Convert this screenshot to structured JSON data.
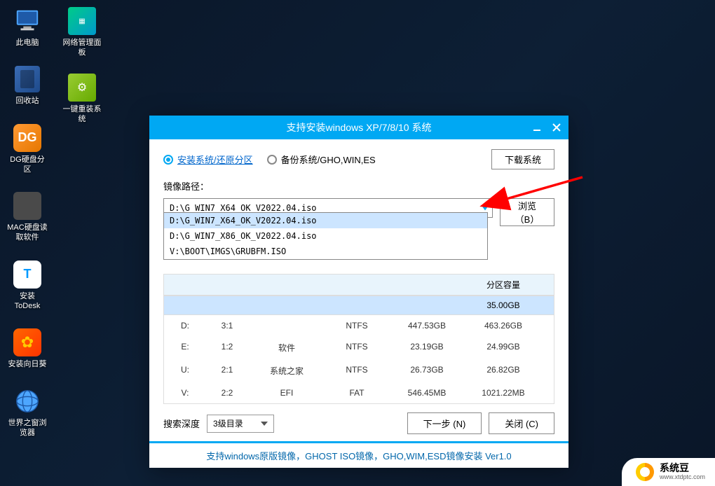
{
  "desktop": {
    "thispc": "此电脑",
    "recycle": "回收站",
    "dg": "DG硬盘分区",
    "mac": "MAC硬盘读取软件",
    "todesk": "安装ToDesk",
    "sunflower": "安装向日葵",
    "browser": "世界之窗浏览器",
    "network": "网络管理面板",
    "reinstall": "一键重装系统"
  },
  "dialog": {
    "title": "支持安装windows XP/7/8/10 系统",
    "radio_install": "安装系统/还原分区",
    "radio_backup": "备份系统/GHO,WIN,ES",
    "download_btn": "下载系统",
    "path_label": "镜像路径：",
    "path_value": "D:\\G_WIN7_X64_OK_V2022.04.iso",
    "browse_btn": "浏览（B）",
    "dropdown": [
      "D:\\G_WIN7_X64_OK_V2022.04.iso",
      "D:\\G_WIN7_X86_OK_V2022.04.iso",
      "V:\\BOOT\\IMGS\\GRUBFM.ISO"
    ],
    "header_partcap": "分区容量",
    "header_partcap_val": "35.00GB",
    "table": [
      {
        "sel": "D:",
        "idx": "3:1",
        "vol": "",
        "fs": "NTFS",
        "used": "447.53GB",
        "cap": "463.26GB"
      },
      {
        "sel": "E:",
        "idx": "1:2",
        "vol": "软件",
        "fs": "NTFS",
        "used": "23.19GB",
        "cap": "24.99GB"
      },
      {
        "sel": "U:",
        "idx": "2:1",
        "vol": "系统之家",
        "fs": "NTFS",
        "used": "26.73GB",
        "cap": "26.82GB"
      },
      {
        "sel": "V:",
        "idx": "2:2",
        "vol": "EFI",
        "fs": "FAT",
        "used": "546.45MB",
        "cap": "1021.22MB"
      }
    ],
    "search_depth_label": "搜索深度",
    "search_depth_value": "3级目录",
    "next_btn": "下一步 (N)",
    "close_btn": "关闭 (C)",
    "footer": "支持windows原版镜像，GHOST ISO镜像，GHO,WIM,ESD镜像安装 Ver1.0"
  },
  "watermark": {
    "main": "系统豆",
    "sub": "www.xtdptc.com"
  }
}
